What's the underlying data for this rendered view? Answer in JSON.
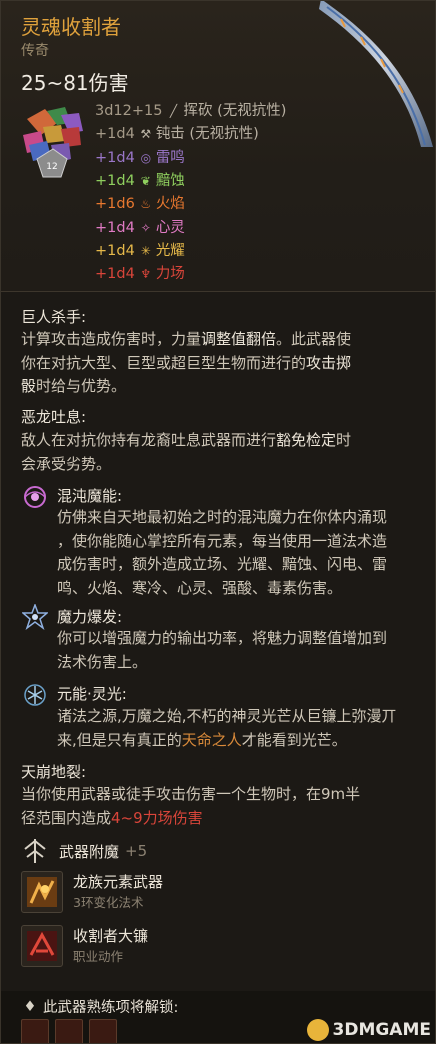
{
  "item": {
    "name": "灵魂收割者",
    "rarity": "传奇",
    "damage_total": "25~81伤害"
  },
  "damage_lines": [
    {
      "amount": "3d12+15",
      "icon": "slash-icon",
      "glyph": "╱",
      "type": "挥砍 (无视抗性)",
      "color": "#a59a88",
      "type_color": "#b9b1a3"
    },
    {
      "amount": "+1d4",
      "icon": "bludgeon-icon",
      "glyph": "⚒",
      "type": "钝击 (无视抗性)",
      "color": "#a59a88",
      "type_color": "#b9b1a3"
    },
    {
      "amount": "+1d4",
      "icon": "thunder-icon",
      "glyph": "◎",
      "type": "雷鸣",
      "color": "#9a76c8",
      "type_color": "#9a76c8"
    },
    {
      "amount": "+1d4",
      "icon": "necrotic-icon",
      "glyph": "❦",
      "type": "黯蚀",
      "color": "#8fcf5e",
      "type_color": "#8fcf5e"
    },
    {
      "amount": "+1d6",
      "icon": "fire-icon",
      "glyph": "♨",
      "type": "火焰",
      "color": "#e8782f",
      "type_color": "#e8782f"
    },
    {
      "amount": "+1d4",
      "icon": "psychic-icon",
      "glyph": "✧",
      "type": "心灵",
      "color": "#e07ac4",
      "type_color": "#e07ac4"
    },
    {
      "amount": "+1d4",
      "icon": "radiant-icon",
      "glyph": "✳",
      "type": "光耀",
      "color": "#e6b94a",
      "type_color": "#e6b94a"
    },
    {
      "amount": "+1d4",
      "icon": "force-icon",
      "glyph": "♆",
      "type": "力场",
      "color": "#d9453a",
      "type_color": "#d9453a"
    }
  ],
  "dice_label": "12",
  "sections": {
    "giant_slayer": {
      "title": "巨人杀手:",
      "l1a": "计算攻击造成伤害时，力量",
      "l1b": "调整值翻倍",
      "l1c": "。此武器使",
      "l2a": "你在对抗大型、巨型或超巨型生物而进行的",
      "l2b": "攻击掷",
      "l3a": "骰",
      "l3b": "时给与优势。"
    },
    "dragon_breath": {
      "title": "恶龙吐息:",
      "l1": "敌人在对抗你持有龙裔吐息武器而进行",
      "l1b": "豁免检定",
      "l1c": "时",
      "l2": "会承受劣势。"
    },
    "chaos_magic": {
      "title": "混沌魔能:",
      "l1": "仿佛来自天地最初始之时的混沌魔力在你体内涌现",
      "l2": "，使你能随心掌控所有元素，每当使用一道法术造",
      "l3": "成伤害时，额外造成立场、光耀、黯蚀、闪电、雷",
      "l4": "鸣、火焰、寒冷、心灵、强酸、毒素伤害。"
    },
    "magic_burst": {
      "title": "魔力爆发:",
      "l1": "你可以增强魔力的输出功率，将魅力调整值增加到",
      "l2": "法术伤害上。"
    },
    "element_light": {
      "title": "元能·灵光:",
      "l1": "诸法之源,万魔之始,不朽的神灵光芒从巨镰上弥漫丌",
      "l2a": "来,但是只有真正的",
      "l2b": "天命之人",
      "l2c": "才能看到光芒。"
    },
    "sky_break": {
      "title": "天崩地裂:",
      "l1": "当你使用武器或徒手攻击伤害一个生物时，在9m半",
      "l2a": "径范围内造成",
      "l2b": "4~9力场伤害"
    }
  },
  "enchant": {
    "label": "武器附魔",
    "value": "+5"
  },
  "features": [
    {
      "name": "龙族元素武器",
      "sub": "3环变化法术"
    },
    {
      "name": "收割者大镰",
      "sub": "职业动作"
    }
  ],
  "footer": {
    "proficiency": "此武器熟练项将解锁:"
  },
  "watermark": "3DMGAME"
}
